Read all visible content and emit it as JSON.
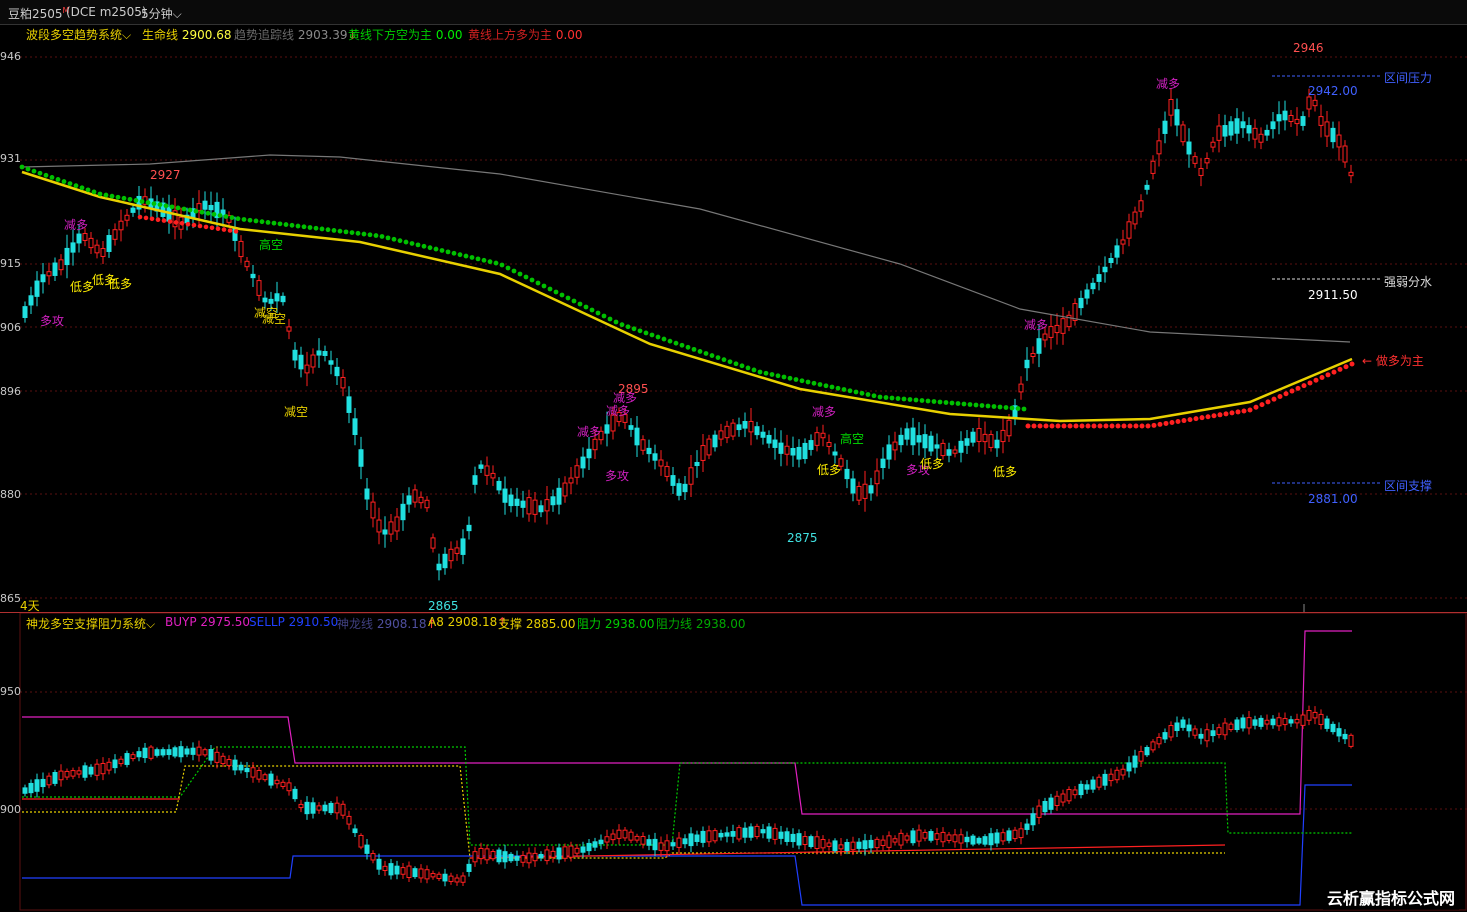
{
  "topbar": {
    "symbol": "豆粕2505",
    "symbol_mark": "M",
    "exchange": "(DCE m2505)",
    "period": "5分钟",
    "period_arrow": "⌵"
  },
  "upper_panel": {
    "indicator_name": "波段多空趋势系统",
    "legend": [
      {
        "label": "生命线",
        "value": "2900.68",
        "color": "#e8d000"
      },
      {
        "label": "趋势追踪线",
        "value": "2903.39",
        "suffix": "↓",
        "color": "#555555"
      },
      {
        "label": "黄线下方空为主",
        "value": "0.00",
        "color": "#00cc00"
      },
      {
        "label": "黄线上方多为主",
        "value": "0.00",
        "color": "#cc2020"
      }
    ],
    "y_ticks": [
      "946",
      "931",
      "915",
      "906",
      "896",
      "880",
      "865"
    ],
    "days_label": "4天",
    "price_labels": {
      "high_2946": "2946",
      "p2927": "2927",
      "p2895": "2895",
      "p2875": "2875",
      "p2865": "2865"
    },
    "zones": [
      {
        "name": "区间压力",
        "value": "2942.00",
        "color": "#4060ff"
      },
      {
        "name": "强弱分水",
        "value": "2911.50",
        "color": "#ffffff"
      },
      {
        "name": "做多为主",
        "value": "",
        "color": "#ff3030"
      },
      {
        "name": "区间支撑",
        "value": "2881.00",
        "color": "#4060ff"
      }
    ],
    "signals": {
      "jian_duo": "减多",
      "jian_kong": "减空",
      "di_duo": "低多",
      "gao_kong": "高空",
      "duo_gong": "多攻"
    }
  },
  "lower_panel": {
    "indicator_name": "神龙多空支撑阻力系统",
    "legend": [
      {
        "label": "BUYP",
        "value": "2975.50",
        "color": "#e020c0"
      },
      {
        "label": "SELLP",
        "value": "2910.50",
        "color": "#2040ff"
      },
      {
        "label": "神龙线",
        "value": "2908.18",
        "suffix": "↑",
        "color": "#404080"
      },
      {
        "label": "A8",
        "value": "2908.18",
        "suffix": "↑",
        "color": "#e8d000"
      },
      {
        "label": "支撑",
        "value": "2885.00",
        "color": "#e8d000"
      },
      {
        "label": "阻力",
        "value": "2938.00",
        "color": "#00cc00"
      },
      {
        "label": "阻力线",
        "value": "2938.00",
        "color": "#00aa00"
      }
    ],
    "y_ticks": [
      "950",
      "900"
    ]
  },
  "watermark": "云析赢指标公式网",
  "colors": {
    "up": "#ff2020",
    "down": "#20e0e0",
    "yellow": "#e8d000",
    "green_dot": "#00c000",
    "red_dot": "#ff2020",
    "grid": "#5a1010"
  }
}
